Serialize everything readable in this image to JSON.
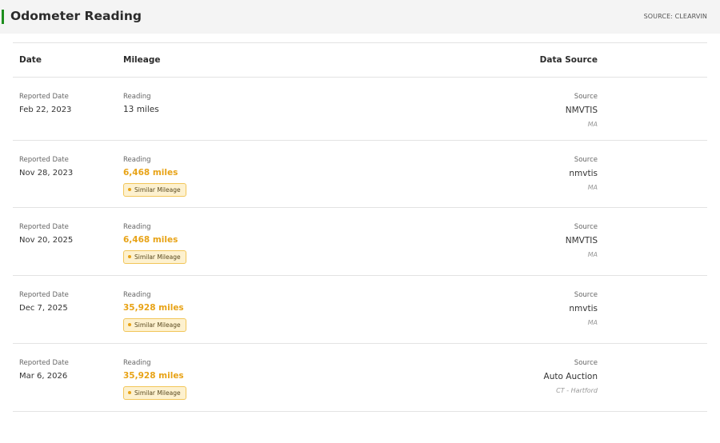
{
  "header": {
    "title": "Odometer Reading",
    "source": "SOURCE: CLEARVIN",
    "accent_color": "#1e8e1e"
  },
  "table": {
    "columns": {
      "date": "Date",
      "mileage": "Mileage",
      "source": "Data Source"
    },
    "rows": [
      {
        "date_label": "Reported Date",
        "date": "Feb 22, 2023",
        "reading_label": "Reading",
        "reading": "13 miles",
        "flagged": false,
        "badge": "",
        "source_label": "Source",
        "source": "NMVTIS",
        "location": "MA"
      },
      {
        "date_label": "Reported Date",
        "date": "Nov 28, 2023",
        "reading_label": "Reading",
        "reading": "6,468 miles",
        "flagged": true,
        "badge": "Similar Mileage",
        "source_label": "Source",
        "source": "nmvtis",
        "location": "MA"
      },
      {
        "date_label": "Reported Date",
        "date": "Nov 20, 2025",
        "reading_label": "Reading",
        "reading": "6,468 miles",
        "flagged": true,
        "badge": "Similar Mileage",
        "source_label": "Source",
        "source": "NMVTIS",
        "location": "MA"
      },
      {
        "date_label": "Reported Date",
        "date": "Dec 7, 2025",
        "reading_label": "Reading",
        "reading": "35,928 miles",
        "flagged": true,
        "badge": "Similar Mileage",
        "source_label": "Source",
        "source": "nmvtis",
        "location": "MA"
      },
      {
        "date_label": "Reported Date",
        "date": "Mar 6, 2026",
        "reading_label": "Reading",
        "reading": "35,928 miles",
        "flagged": true,
        "badge": "Similar Mileage",
        "source_label": "Source",
        "source": "Auto Auction",
        "location": "CT - Hartford"
      }
    ]
  },
  "colors": {
    "warning": "#e8a317",
    "badge_bg": "#fdf1cf",
    "badge_border": "#f2c65a"
  }
}
